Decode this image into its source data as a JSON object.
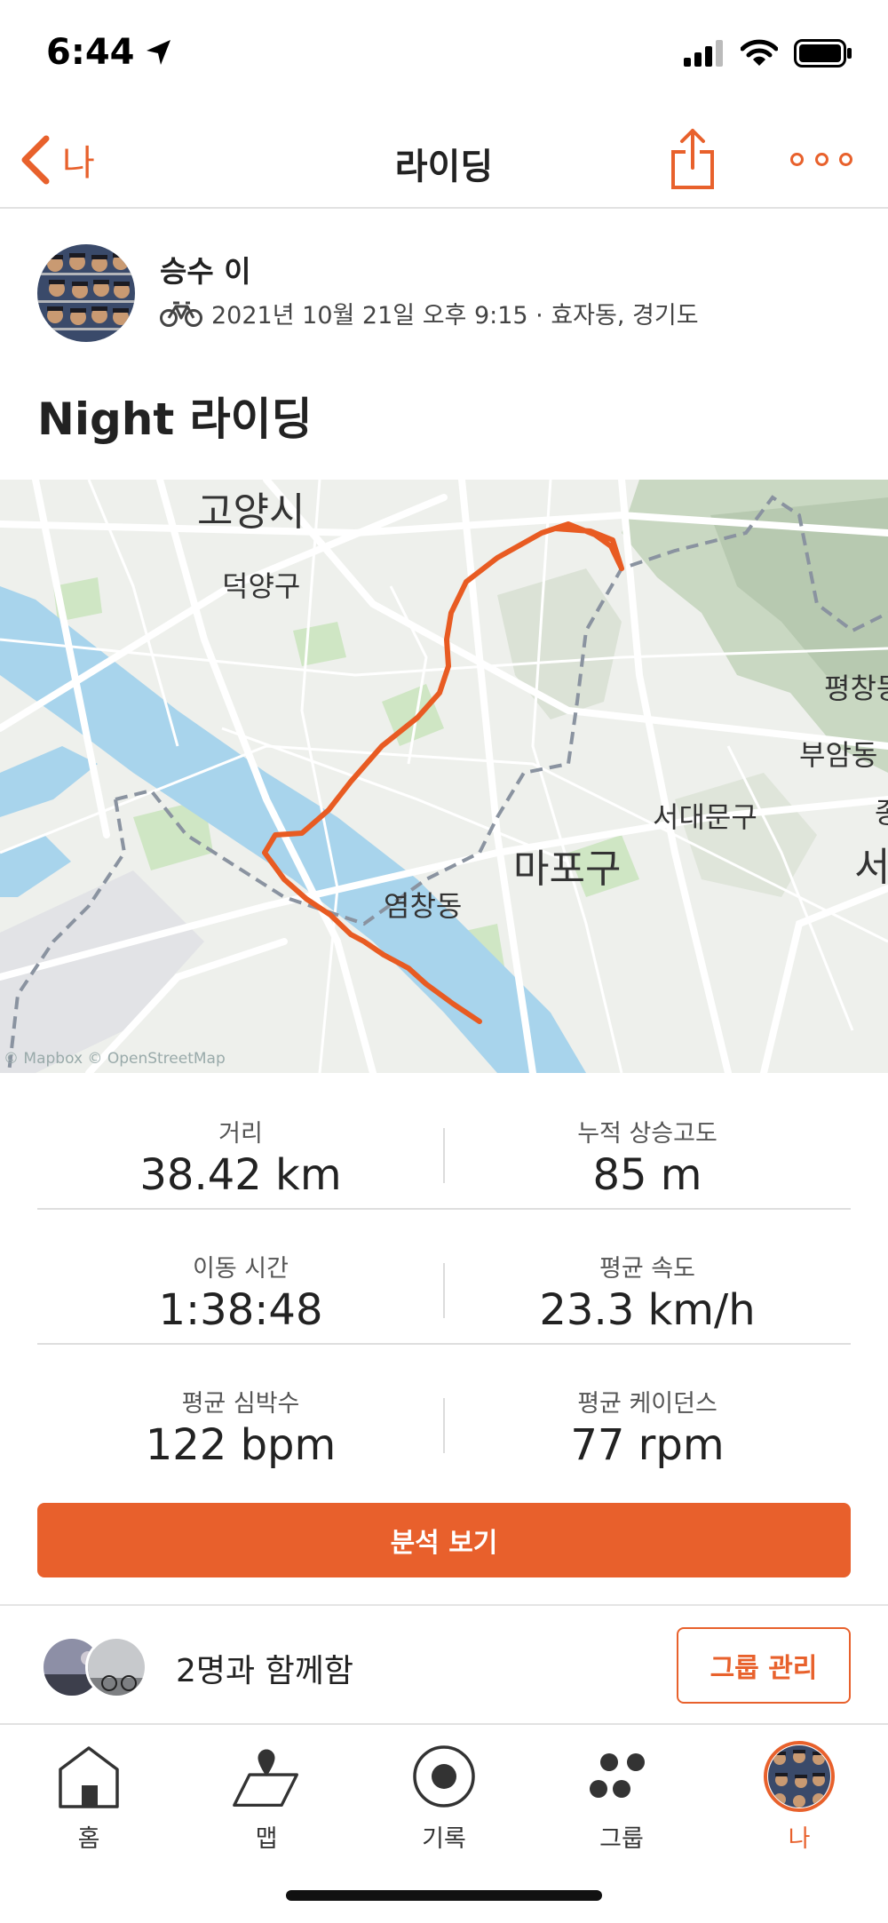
{
  "status_bar": {
    "time": "6:44"
  },
  "nav": {
    "back_label": "나",
    "title": "라이딩"
  },
  "athlete": {
    "name": "승수 이",
    "meta": "2021년 10월 21일 오후 9:15 · 효자동, 경기도"
  },
  "activity": {
    "title": "Night 라이딩"
  },
  "map": {
    "labels": [
      "고양시",
      "덕양구",
      "평창동",
      "부암동",
      "서대문구",
      "마포구",
      "염창동",
      "종",
      "서"
    ],
    "attribution": "© Mapbox © OpenStreetMap"
  },
  "stats": [
    {
      "label": "거리",
      "value": "38.42 km"
    },
    {
      "label": "누적 상승고도",
      "value": "85 m"
    },
    {
      "label": "이동 시간",
      "value": "1:38:48"
    },
    {
      "label": "평균 속도",
      "value": "23.3 km/h"
    },
    {
      "label": "평균 심박수",
      "value": "122 bpm"
    },
    {
      "label": "평균 케이던스",
      "value": "77 rpm"
    }
  ],
  "analyze_button": "분석 보기",
  "group": {
    "text": "2명과 함께함",
    "button": "그룹 관리"
  },
  "tabs": [
    {
      "label": "홈",
      "icon": "home-icon"
    },
    {
      "label": "맵",
      "icon": "map-icon"
    },
    {
      "label": "기록",
      "icon": "record-icon"
    },
    {
      "label": "그룹",
      "icon": "groups-icon"
    },
    {
      "label": "나",
      "icon": "profile-avatar-icon"
    }
  ],
  "colors": {
    "accent": "#e8612c",
    "route": "#e85b22",
    "water": "#a8d4ec",
    "park": "#cfe6c4"
  }
}
